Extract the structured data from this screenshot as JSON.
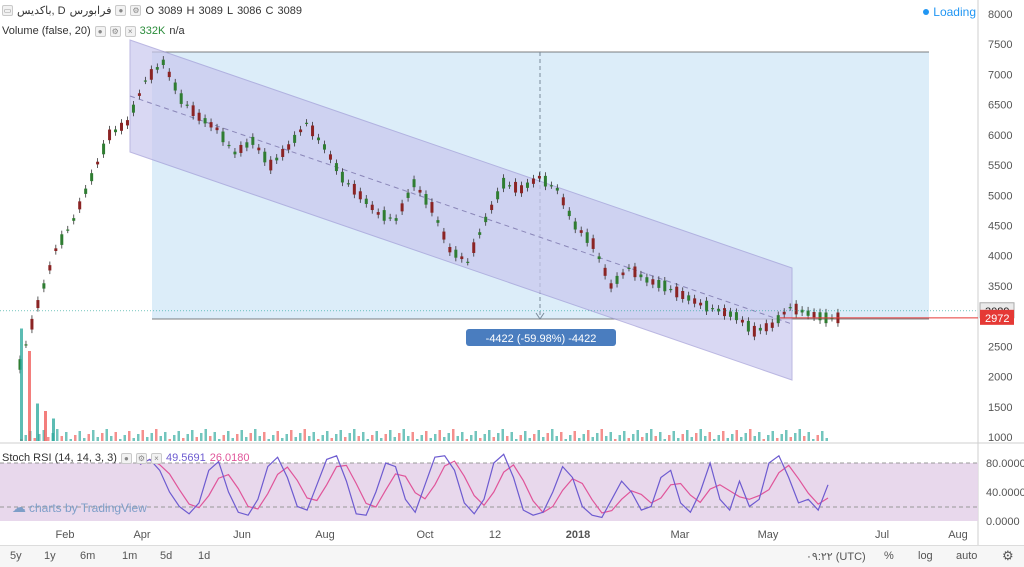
{
  "header": {
    "symbol": "فرابورس",
    "name": "باکدیس, D",
    "ohlc": {
      "o_label": "O",
      "o": "3089",
      "h_label": "H",
      "h": "3089",
      "l_label": "L",
      "l": "3086",
      "c_label": "C",
      "c": "3089"
    },
    "volume_label": "Volume (false, 20)",
    "volume_value": "332K",
    "volume_na": "n/a",
    "loading": "Loading"
  },
  "colors": {
    "up": "#26a69a",
    "down": "#ef5350",
    "candle_body_up": "#2f7d32",
    "candle_body_down": "#8b2424",
    "channel": "#c9c8ee",
    "range": "#d6eaf8",
    "stoch_bg": "#e6d4ea",
    "k_line": "#6d5bd0",
    "d_line": "#e0559a"
  },
  "chart_data": [
    {
      "type": "candlestick",
      "title": "",
      "ylim": [
        900,
        8100
      ],
      "y_ticks": [
        "8000",
        "7500",
        "7000",
        "6500",
        "6000",
        "5500",
        "5000",
        "4500",
        "4000",
        "3500",
        "3000",
        "2500",
        "2000",
        "1500",
        "1000"
      ],
      "x_ticks": [
        "Feb",
        "Apr",
        "Jun",
        "Aug",
        "Oct",
        "12",
        "2018",
        "Mar",
        "May",
        "Jul",
        "Aug"
      ],
      "price_labels": {
        "last": "3089",
        "ref": "2972"
      },
      "measure_label": "-4422 (-59.98%) -4422",
      "close_path": [
        {
          "x": "Jan 15",
          "y": 2200
        },
        {
          "x": "Jan 22",
          "y": 3200
        },
        {
          "x": "Feb 1",
          "y": 4100
        },
        {
          "x": "Feb 12",
          "y": 4600
        },
        {
          "x": "Feb 22",
          "y": 5300
        },
        {
          "x": "Mar 5",
          "y": 6000
        },
        {
          "x": "Mar 15",
          "y": 6200
        },
        {
          "x": "Mar 25",
          "y": 6900
        },
        {
          "x": "Apr 3",
          "y": 7200
        },
        {
          "x": "Apr 12",
          "y": 6600
        },
        {
          "x": "Apr 25",
          "y": 6300
        },
        {
          "x": "May 8",
          "y": 6100
        },
        {
          "x": "May 20",
          "y": 5700
        },
        {
          "x": "Jun 2",
          "y": 5900
        },
        {
          "x": "Jun 15",
          "y": 5500
        },
        {
          "x": "Jun 28",
          "y": 5800
        },
        {
          "x": "Jul 10",
          "y": 6200
        },
        {
          "x": "Jul 22",
          "y": 5800
        },
        {
          "x": "Aug 5",
          "y": 5300
        },
        {
          "x": "Aug 18",
          "y": 5000
        },
        {
          "x": "Sep 1",
          "y": 4700
        },
        {
          "x": "Sep 12",
          "y": 4600
        },
        {
          "x": "Sep 22",
          "y": 5200
        },
        {
          "x": "Oct 3",
          "y": 4800
        },
        {
          "x": "Oct 13",
          "y": 4100
        },
        {
          "x": "Oct 25",
          "y": 3900
        },
        {
          "x": "Nov 5",
          "y": 4600
        },
        {
          "x": "Nov 15",
          "y": 5200
        },
        {
          "x": "Nov 25",
          "y": 5100
        },
        {
          "x": "Dec 5",
          "y": 5300
        },
        {
          "x": "Dec 15",
          "y": 5100
        },
        {
          "x": "Dec 25",
          "y": 4500
        },
        {
          "x": "Jan 5",
          "y": 4200
        },
        {
          "x": "Jan 12",
          "y": 3500
        },
        {
          "x": "Jan 20",
          "y": 3800
        },
        {
          "x": "Feb 1",
          "y": 3600
        },
        {
          "x": "Feb 12",
          "y": 3500
        },
        {
          "x": "Feb 25",
          "y": 3350
        },
        {
          "x": "Mar 8",
          "y": 3200
        },
        {
          "x": "Mar 20",
          "y": 3100
        },
        {
          "x": "Apr 1",
          "y": 3000
        },
        {
          "x": "Apr 10",
          "y": 2750
        },
        {
          "x": "Apr 20",
          "y": 2850
        },
        {
          "x": "Apr 28",
          "y": 3150
        },
        {
          "x": "May 5",
          "y": 3050
        },
        {
          "x": "May 15",
          "y": 2972
        }
      ],
      "volume_spikes": [
        {
          "x": "Jan 18",
          "v": 7.5
        },
        {
          "x": "Jan 24",
          "v": 6.0
        },
        {
          "x": "Jan 28",
          "v": 2.5
        },
        {
          "x": "Feb 2",
          "v": 2.0
        },
        {
          "x": "Feb 8",
          "v": 1.5
        }
      ]
    },
    {
      "type": "line",
      "title": "Stoch RSI (14, 14, 3, 3)",
      "series": [
        {
          "name": "K",
          "value": "49.5691"
        },
        {
          "name": "D",
          "value": "26.0180"
        }
      ],
      "ylim": [
        0,
        90
      ],
      "y_ticks": [
        "80.0000",
        "40.0000",
        "0.0000"
      ],
      "k_values": [
        78,
        85,
        70,
        40,
        20,
        10,
        25,
        70,
        82,
        40,
        12,
        8,
        30,
        75,
        88,
        60,
        20,
        15,
        50,
        85,
        90,
        55,
        10,
        8,
        40,
        80,
        75,
        30,
        12,
        50,
        88,
        90,
        70,
        25,
        10,
        30,
        80,
        92,
        60,
        15,
        8,
        12,
        40,
        75,
        60,
        20,
        8,
        5,
        30,
        55,
        40,
        15,
        20,
        60,
        70,
        25,
        12,
        40,
        80,
        30,
        15,
        55,
        20,
        30,
        80,
        90,
        60,
        25,
        30,
        15,
        50
      ]
    }
  ],
  "watermark": "charts by TradingView",
  "bottom": {
    "timeframes": [
      "5y",
      "1y",
      "6m",
      "1m",
      "5d",
      "1d"
    ],
    "time": "۰۹:۲۲ (UTC)",
    "percent": "%",
    "log": "log",
    "auto": "auto",
    "settings_icon": "gear-icon"
  }
}
